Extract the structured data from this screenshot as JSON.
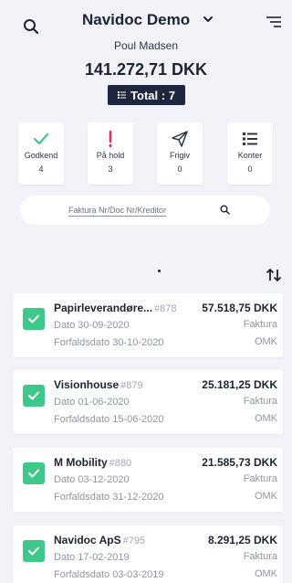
{
  "header": {
    "title": "Navidoc Demo",
    "user": "Poul Madsen",
    "amount": "141.272,71 DKK",
    "total_label": "Total : 7"
  },
  "tiles": [
    {
      "label": "Godkend",
      "count": "4",
      "icon": "check-icon",
      "color": "#3ec98a"
    },
    {
      "label": "På hold",
      "count": "3",
      "icon": "exclamation-icon",
      "color": "#e0315a"
    },
    {
      "label": "Frigiv",
      "count": "0",
      "icon": "send-icon",
      "color": "#2d3447"
    },
    {
      "label": "Konter",
      "count": "0",
      "icon": "list-icon",
      "color": "#2d3447"
    }
  ],
  "search": {
    "placeholder": "Faktura Nr/Doc Nr/Kreditor"
  },
  "invoices": [
    {
      "vendor": "Papirleverandøre...",
      "docnr": "#878",
      "dato": "Dato 30-09-2020",
      "forfald": "Forfaldsdato 30-10-2020",
      "amount": "57.518,75 DKK",
      "type": "Faktura",
      "dept": "OMK"
    },
    {
      "vendor": "Visionhouse",
      "docnr": "#879",
      "dato": "Dato 01-06-2020",
      "forfald": "Forfaldsdato 15-06-2020",
      "amount": "25.181,25 DKK",
      "type": "Faktura",
      "dept": "OMK"
    },
    {
      "vendor": "M Mobility",
      "docnr": "#880",
      "dato": "Dato 03-12-2020",
      "forfald": "Forfaldsdato 31-12-2020",
      "amount": "21.585,73 DKK",
      "type": "Faktura",
      "dept": "OMK"
    },
    {
      "vendor": "Navidoc ApS",
      "docnr": "#795",
      "dato": "Dato 17-02-2019",
      "forfald": "Forfaldsdato 03-03-2019",
      "amount": "8.291,25 DKK",
      "type": "Faktura",
      "dept": "OMK"
    }
  ],
  "colors": {
    "accent_green": "#3ec98a",
    "hold_red": "#e0315a",
    "dark_navy": "#1f2740"
  }
}
